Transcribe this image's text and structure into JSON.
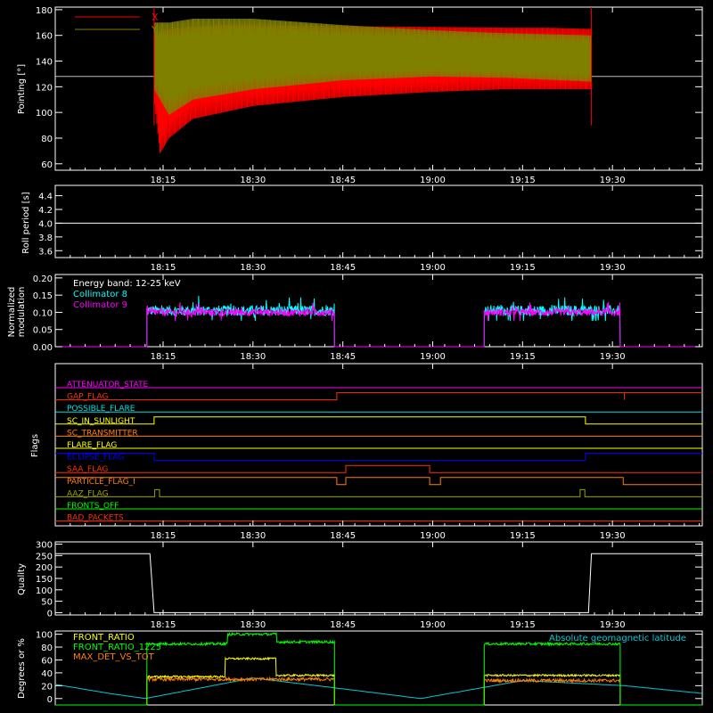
{
  "time_axis": {
    "tick_labels": [
      "18:15",
      "18:30",
      "18:45",
      "19:00",
      "19:15",
      "19:30"
    ],
    "tick_values_minutes": [
      1095,
      1110,
      1125,
      1140,
      1155,
      1170
    ],
    "range_minutes": [
      1077,
      1185
    ]
  },
  "panels": {
    "pointing": {
      "ylabel": "Pointing [°]",
      "yticks": [
        "60",
        "80",
        "100",
        "120",
        "140",
        "160",
        "180"
      ]
    },
    "roll": {
      "ylabel": "Roll period [s]",
      "yticks": [
        "3.6",
        "3.8",
        "4.0",
        "4.2",
        "4.4"
      ]
    },
    "modulation": {
      "ylabel_line1": "Normalized",
      "ylabel_line2": "modulation",
      "yticks": [
        "0.00",
        "0.05",
        "0.10",
        "0.15",
        "0.20"
      ],
      "annotation": "Energy band: 12-25 keV"
    },
    "flags": {
      "ylabel": "Flags"
    },
    "quality": {
      "ylabel": "Quality",
      "yticks": [
        "0",
        "50",
        "100",
        "150",
        "200",
        "250",
        "300"
      ]
    },
    "degrees": {
      "ylabel": "Degrees or %",
      "yticks": [
        "0",
        "20",
        "40",
        "60",
        "80",
        "100"
      ],
      "annotation": "Absolute geomagnetic latitude"
    }
  },
  "chart_data": [
    {
      "type": "line",
      "panel": "pointing",
      "ylabel": "Pointing [°]",
      "ylim": [
        55,
        182
      ],
      "series": [
        {
          "name": "X",
          "color": "#ff0000",
          "upper": [
            [
              1093.5,
              160
            ],
            [
              1096,
              165
            ],
            [
              1105,
              168
            ],
            [
              1130,
              167
            ],
            [
              1152,
              166
            ],
            [
              1159,
              166
            ],
            [
              1166.5,
              165
            ]
          ],
          "lower": [
            [
              1093.5,
              110
            ],
            [
              1094.5,
              68
            ],
            [
              1096,
              80
            ],
            [
              1100,
              95
            ],
            [
              1110,
              105
            ],
            [
              1125,
              112
            ],
            [
              1140,
              116
            ],
            [
              1152,
              118
            ],
            [
              1166.5,
              118
            ]
          ]
        },
        {
          "name": "Y",
          "color": "#808000",
          "upper": [
            [
              1093.5,
              170
            ],
            [
              1096,
              170
            ],
            [
              1100,
              173
            ],
            [
              1110,
              173
            ],
            [
              1125,
              168
            ],
            [
              1140,
              164
            ],
            [
              1150,
              162
            ],
            [
              1166.5,
              160
            ]
          ],
          "lower": [
            [
              1093.5,
              118
            ],
            [
              1096,
              98
            ],
            [
              1100,
              110
            ],
            [
              1110,
              118
            ],
            [
              1125,
              125
            ],
            [
              1140,
              128
            ],
            [
              1152,
              127
            ],
            [
              1166.5,
              124
            ]
          ]
        }
      ],
      "reference_line": 128,
      "vertical_markers": [
        1093.5,
        1166.5
      ]
    },
    {
      "type": "line",
      "panel": "roll",
      "ylabel": "Roll period [s]",
      "ylim": [
        3.5,
        4.55
      ],
      "series": [
        {
          "name": "",
          "color": "#ffffff",
          "points": [
            [
              1077,
              4.0
            ],
            [
              1185,
              4.0
            ]
          ]
        }
      ]
    },
    {
      "type": "line",
      "panel": "modulation",
      "ylim": [
        0.0,
        0.21
      ],
      "series": [
        {
          "name": "Collimator 8",
          "color": "#00ffff",
          "active": [
            [
              1092.3,
              1123.6
            ],
            [
              1148.6,
              1171.3
            ]
          ],
          "level": 0.105,
          "noise": 0.03
        },
        {
          "name": "Collimator 9",
          "color": "#ff00ff",
          "active": [
            [
              1092.3,
              1123.6
            ],
            [
              1148.6,
              1171.3
            ]
          ],
          "level": 0.1,
          "noise": 0.02
        }
      ]
    },
    {
      "type": "line",
      "panel": "flags",
      "flags": [
        {
          "name": "ATTENUATOR_STATE",
          "color": "#ff00ff",
          "steps": [
            [
              1077,
              0
            ],
            [
              1185,
              0
            ]
          ]
        },
        {
          "name": "GAP_FLAG",
          "color": "#ff3000",
          "steps": [
            [
              1077,
              0
            ],
            [
              1124,
              0
            ],
            [
              1124,
              1
            ],
            [
              1172,
              1
            ],
            [
              1172,
              0
            ],
            [
              1172,
              1
            ],
            [
              1185,
              1
            ]
          ]
        },
        {
          "name": "POSSIBLE_FLARE",
          "color": "#00e0e0",
          "steps": [
            [
              1077,
              0
            ],
            [
              1185,
              0
            ]
          ]
        },
        {
          "name": "SC_IN_SUNLIGHT",
          "color": "#ffff00",
          "steps": [
            [
              1077,
              0
            ],
            [
              1093.5,
              0
            ],
            [
              1093.5,
              1
            ],
            [
              1165.5,
              1
            ],
            [
              1165.5,
              0
            ],
            [
              1185,
              0
            ]
          ]
        },
        {
          "name": "SC_TRANSMITTER",
          "color": "#ff8000",
          "steps": [
            [
              1077,
              0
            ],
            [
              1185,
              0
            ]
          ]
        },
        {
          "name": "FLARE_FLAG",
          "color": "#ffff00",
          "steps": [
            [
              1077,
              0
            ],
            [
              1185,
              0
            ]
          ]
        },
        {
          "name": "ECLIPSE_FLAG",
          "color": "#0000ff",
          "steps": [
            [
              1077,
              1
            ],
            [
              1093.5,
              1
            ],
            [
              1093.5,
              0
            ],
            [
              1165.5,
              0
            ],
            [
              1165.5,
              1
            ],
            [
              1185,
              1
            ]
          ]
        },
        {
          "name": "SAA_FLAG",
          "color": "#ff3000",
          "steps": [
            [
              1077,
              0
            ],
            [
              1125.5,
              0
            ],
            [
              1125.5,
              1
            ],
            [
              1139.5,
              1
            ],
            [
              1139.5,
              0
            ],
            [
              1185,
              0
            ]
          ]
        },
        {
          "name": "PARTICLE_FLAG_I",
          "color": "#ff8000",
          "steps": [
            [
              1077,
              1
            ],
            [
              1124,
              1
            ],
            [
              1124,
              0
            ],
            [
              1125.5,
              0
            ],
            [
              1125.5,
              1
            ],
            [
              1139.5,
              1
            ],
            [
              1139.5,
              0
            ],
            [
              1141.3,
              0
            ],
            [
              1141.3,
              1
            ],
            [
              1171.8,
              1
            ],
            [
              1171.8,
              0
            ],
            [
              1185,
              0
            ]
          ]
        },
        {
          "name": "AAZ_FLAG",
          "color": "#a0a000",
          "steps": [
            [
              1077,
              0
            ],
            [
              1093.6,
              0
            ],
            [
              1093.6,
              1
            ],
            [
              1094.4,
              1
            ],
            [
              1094.4,
              0
            ],
            [
              1164.6,
              0
            ],
            [
              1164.6,
              1
            ],
            [
              1165.4,
              1
            ],
            [
              1165.4,
              0
            ],
            [
              1185,
              0
            ]
          ]
        },
        {
          "name": "FRONTS_OFF",
          "color": "#00ff00",
          "steps": [
            [
              1077,
              0
            ],
            [
              1185,
              0
            ]
          ]
        },
        {
          "name": "BAD_PACKETS",
          "color": "#ff3000",
          "steps": [
            [
              1077,
              0
            ],
            [
              1185,
              0
            ]
          ]
        }
      ]
    },
    {
      "type": "line",
      "panel": "quality",
      "ylim": [
        -10,
        310
      ],
      "series": [
        {
          "name": "",
          "color": "#ffffff",
          "points": [
            [
              1077,
              258
            ],
            [
              1092.8,
              258
            ],
            [
              1093.5,
              0
            ],
            [
              1166,
              0
            ],
            [
              1166.5,
              258
            ],
            [
              1185,
              258
            ]
          ]
        }
      ]
    },
    {
      "type": "line",
      "panel": "degrees",
      "ylim": [
        -10,
        105
      ],
      "series": [
        {
          "name": "FRONT_RATIO",
          "color": "#ffff00",
          "active": [
            [
              1092.3,
              1123.6
            ],
            [
              1148.6,
              1171.3
            ]
          ],
          "segments": [
            [
              1092.3,
              1105.3,
              34
            ],
            [
              1105.3,
              1113.8,
              62
            ],
            [
              1113.8,
              1123.6,
              36
            ],
            [
              1148.6,
              1171.3,
              36
            ]
          ],
          "noise": 3
        },
        {
          "name": "FRONT_RATIO_1225",
          "color": "#00ff00",
          "active": [
            [
              1092.3,
              1123.6
            ],
            [
              1148.6,
              1171.3
            ]
          ],
          "segments": [
            [
              1092.3,
              1105.7,
              85
            ],
            [
              1105.7,
              1113.9,
              100
            ],
            [
              1113.9,
              1123.6,
              88
            ],
            [
              1148.6,
              1171.3,
              85
            ]
          ],
          "noise": 4
        },
        {
          "name": "MAX_DET_VS_TOT",
          "color": "#ff8000",
          "active": [
            [
              1092.3,
              1123.6
            ],
            [
              1148.6,
              1171.3
            ]
          ],
          "segments": [
            [
              1092.3,
              1123.6,
              30
            ],
            [
              1148.6,
              1171.3,
              28
            ]
          ],
          "noise": 5
        },
        {
          "name": "Absolute geomagnetic latitude",
          "color": "#00c8d8",
          "points": [
            [
              1077,
              22
            ],
            [
              1086,
              8
            ],
            [
              1092,
              0
            ],
            [
              1110,
              32
            ],
            [
              1126,
              14
            ],
            [
              1138,
              0
            ],
            [
              1155,
              28
            ],
            [
              1172,
              20
            ],
            [
              1185,
              8
            ]
          ]
        }
      ]
    }
  ]
}
